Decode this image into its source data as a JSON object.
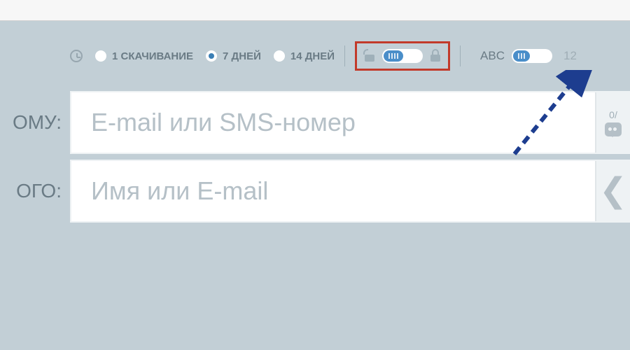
{
  "toolbar": {
    "radios": [
      {
        "label": "1 СКАЧИВАНИЕ",
        "selected": false
      },
      {
        "label": "7 ДНЕЙ",
        "selected": true
      },
      {
        "label": "14 ДНЕЙ",
        "selected": false
      }
    ],
    "abc_label": "ABC",
    "abc_count": "12"
  },
  "fields": {
    "to_label": "ОМУ:",
    "to_placeholder": "E-mail или SMS-номер",
    "from_label": "ОГО:",
    "from_placeholder": "Имя или E-mail",
    "badge_count": "0/"
  }
}
